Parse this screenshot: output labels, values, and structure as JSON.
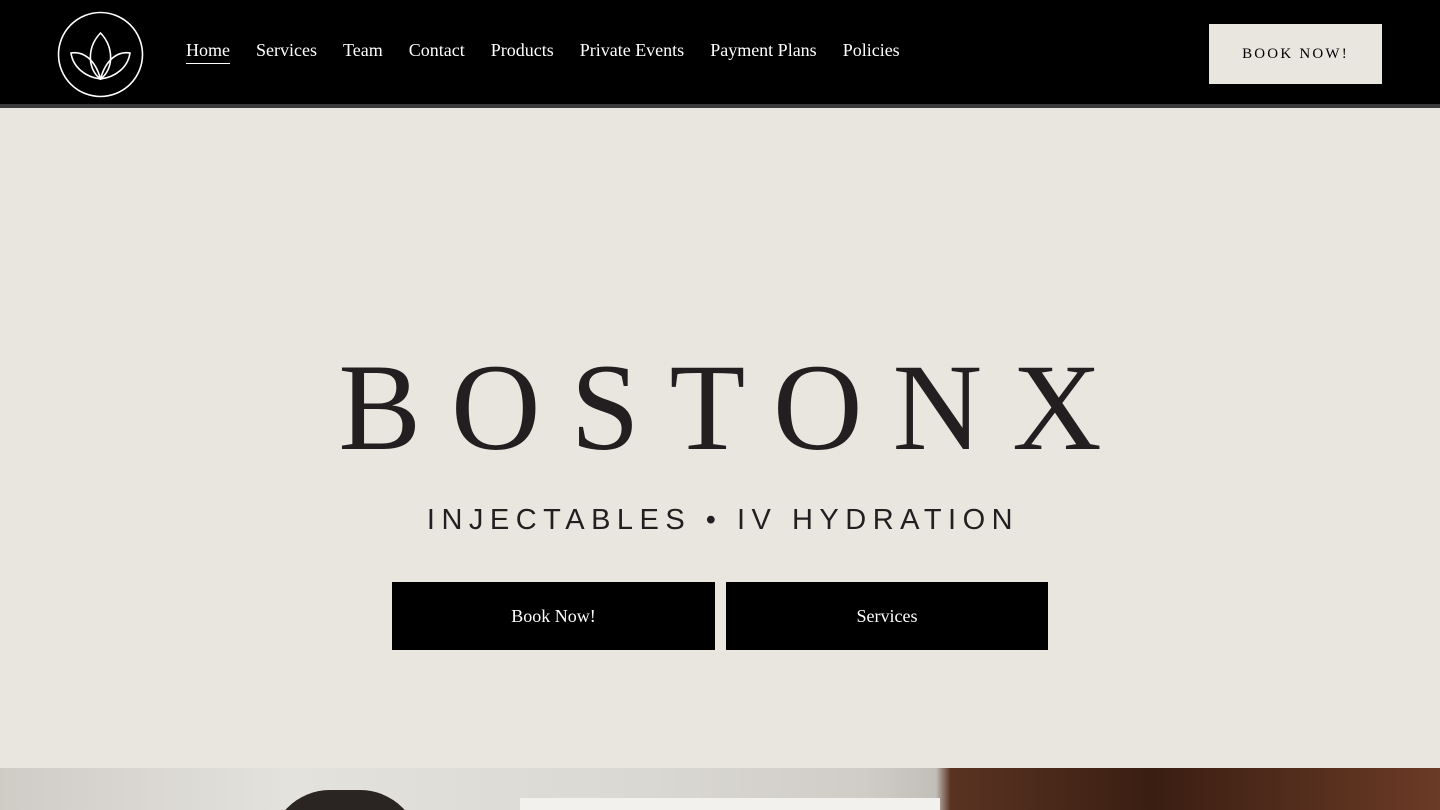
{
  "header": {
    "logo": "lotus-logo-icon",
    "nav": [
      {
        "label": "Home",
        "active": true
      },
      {
        "label": "Services",
        "active": false
      },
      {
        "label": "Team",
        "active": false
      },
      {
        "label": "Contact",
        "active": false
      },
      {
        "label": "Products",
        "active": false
      },
      {
        "label": "Private Events",
        "active": false
      },
      {
        "label": "Payment Plans",
        "active": false
      },
      {
        "label": "Policies",
        "active": false
      }
    ],
    "book_label": "BOOK NOW!"
  },
  "hero": {
    "title": "BOSTONX",
    "subtitle": "INJECTABLES • IV HYDRATION",
    "primary_cta": "Book Now!",
    "secondary_cta": "Services"
  },
  "colors": {
    "header_bg": "#000000",
    "page_bg": "#e9e6e0",
    "text_dark": "#231f20",
    "button_bg": "#000000"
  }
}
